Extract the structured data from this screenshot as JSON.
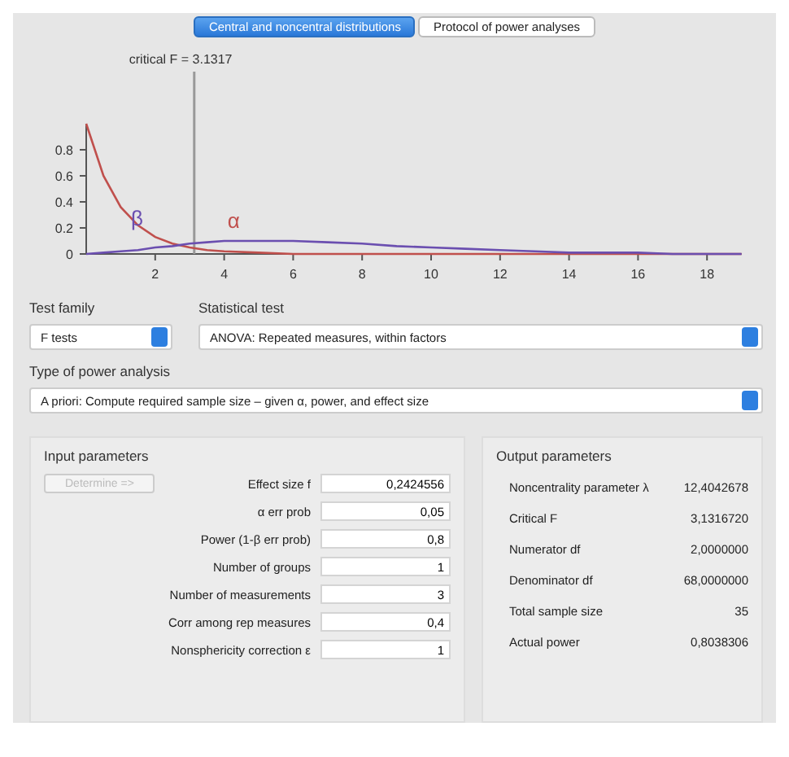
{
  "tabs": [
    {
      "label": "Central and noncentral distributions",
      "selected": true
    },
    {
      "label": "Protocol of power analyses",
      "selected": false
    }
  ],
  "chart": {
    "beta_label": "β",
    "alpha_label": "α",
    "chart_data": {
      "type": "line",
      "x": [
        0,
        0.5,
        1,
        1.5,
        2,
        2.5,
        3,
        3.5,
        4,
        5,
        6,
        7,
        8,
        9,
        10,
        11,
        12,
        13,
        14,
        15,
        16,
        17,
        18,
        19
      ],
      "series": [
        {
          "color": "#c0504d",
          "values": [
            1.0,
            0.6,
            0.36,
            0.22,
            0.13,
            0.08,
            0.05,
            0.03,
            0.02,
            0.01,
            0,
            0,
            0,
            0,
            0,
            0,
            0,
            0,
            0,
            0,
            0,
            0,
            0,
            0
          ]
        },
        {
          "color": "#6b4fb0",
          "values": [
            0,
            0.01,
            0.02,
            0.03,
            0.05,
            0.06,
            0.08,
            0.09,
            0.1,
            0.1,
            0.1,
            0.09,
            0.08,
            0.06,
            0.05,
            0.04,
            0.03,
            0.02,
            0.01,
            0.01,
            0.01,
            0,
            0,
            0
          ]
        }
      ],
      "ref_lines": [
        {
          "axis": "x",
          "value": 3.1317,
          "label": "critical F = 3.1317"
        }
      ],
      "xlim": [
        0,
        19
      ],
      "ylim": [
        0,
        1
      ],
      "xticks": [
        2,
        4,
        6,
        8,
        10,
        12,
        14,
        16,
        18
      ],
      "yticks": [
        0,
        {
          "value": 0.2,
          "label": "0.2"
        },
        {
          "value": 0.4,
          "label": "0.4"
        },
        {
          "value": 0.6,
          "label": "0.6"
        },
        {
          "value": 0.8,
          "label": "0.8"
        }
      ]
    }
  },
  "test_family": {
    "label": "Test family",
    "value": "F tests"
  },
  "statistical_test": {
    "label": "Statistical test",
    "value": "ANOVA: Repeated measures, within factors"
  },
  "power_analysis": {
    "label": "Type of power analysis",
    "value": "A priori: Compute required sample size – given α, power, and effect size"
  },
  "input": {
    "title": "Input parameters",
    "determine": {
      "label": "Determine =>",
      "disabled": true
    },
    "fields": [
      {
        "label": "Effect size f",
        "value": "0,2424556"
      },
      {
        "label": "α err prob",
        "value": "0,05"
      },
      {
        "label": "Power (1-β err prob)",
        "value": "0,8"
      },
      {
        "label": "Number of groups",
        "value": "1"
      },
      {
        "label": "Number of measurements",
        "value": "3"
      },
      {
        "label": "Corr among rep measures",
        "value": "0,4"
      },
      {
        "label": "Nonsphericity correction ε",
        "value": "1"
      }
    ]
  },
  "output": {
    "title": "Output parameters",
    "fields": [
      {
        "label": "Noncentrality parameter λ",
        "value": "12,4042678"
      },
      {
        "label": "Critical F",
        "value": "3,1316720"
      },
      {
        "label": "Numerator df",
        "value": "2,0000000"
      },
      {
        "label": "Denominator df",
        "value": "68,0000000"
      },
      {
        "label": "Total sample size",
        "value": "35"
      },
      {
        "label": "Actual power",
        "value": "0,8038306"
      }
    ]
  }
}
